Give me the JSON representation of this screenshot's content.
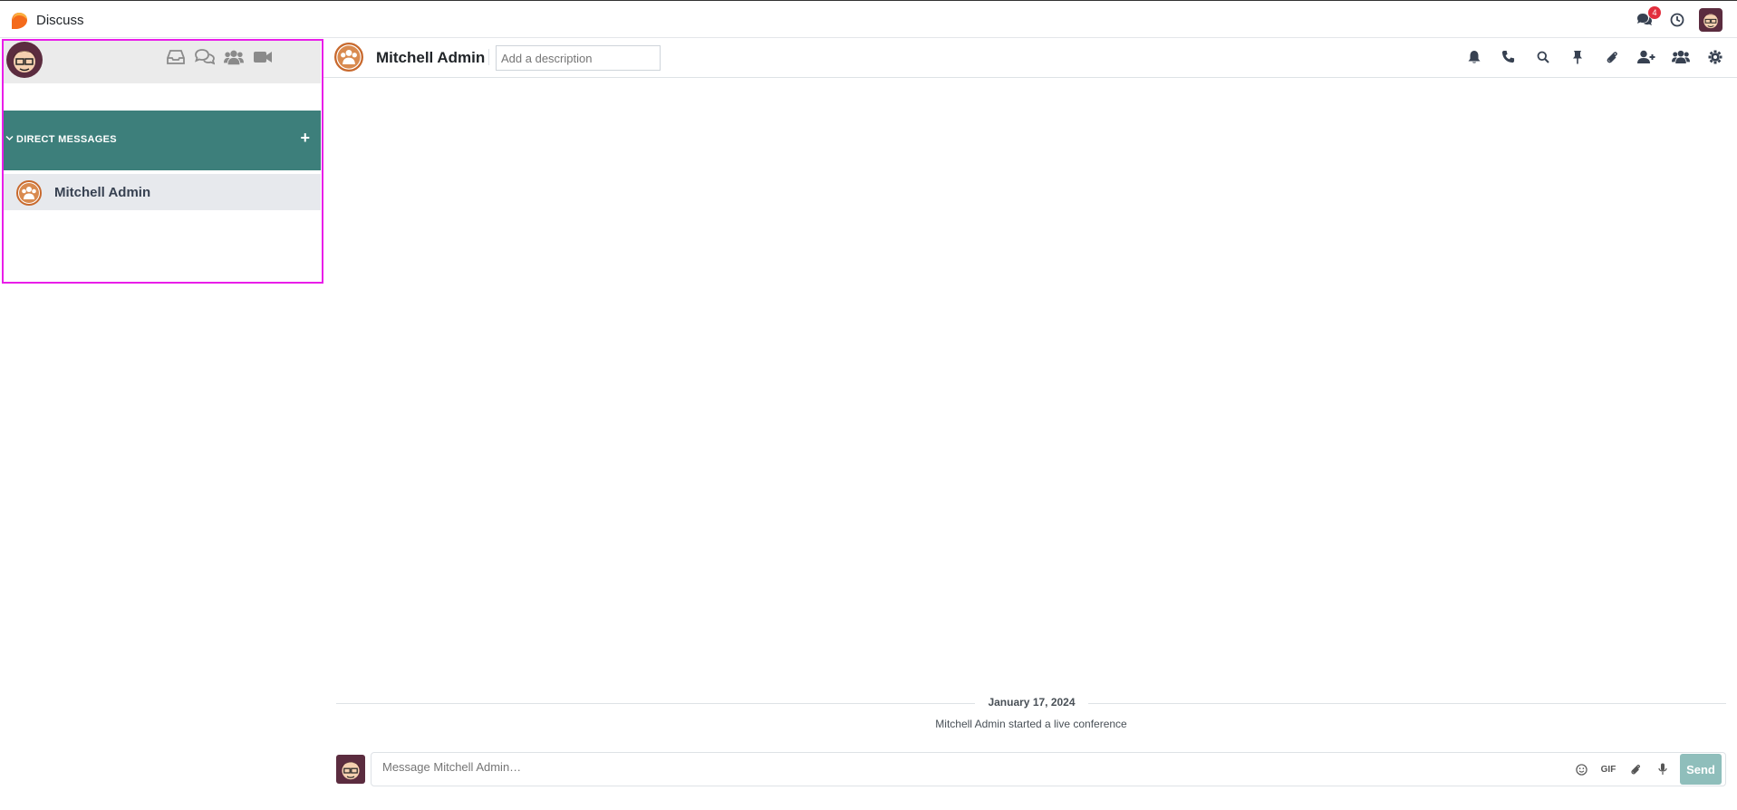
{
  "app": {
    "name": "Discuss"
  },
  "topbar": {
    "messages_badge": "4"
  },
  "sidebar": {
    "section_title": "DIRECT MESSAGES",
    "add_symbol": "+",
    "items": [
      {
        "label": "Mitchell Admin"
      }
    ]
  },
  "thread": {
    "name": "Mitchell Admin",
    "description_placeholder": "Add a description"
  },
  "messages": {
    "date": "January 17, 2024",
    "notification": "Mitchell Admin started a live conference"
  },
  "composer": {
    "placeholder": "Message Mitchell Admin…",
    "gif_label": "GIF",
    "send_label": "Send"
  },
  "colors": {
    "section_bg": "#3d7f7b",
    "selected_item_bg": "#e7e9ed",
    "badge": "#e22e3d",
    "send_button": "#8fbebb",
    "highlight": "#e91ee9"
  }
}
